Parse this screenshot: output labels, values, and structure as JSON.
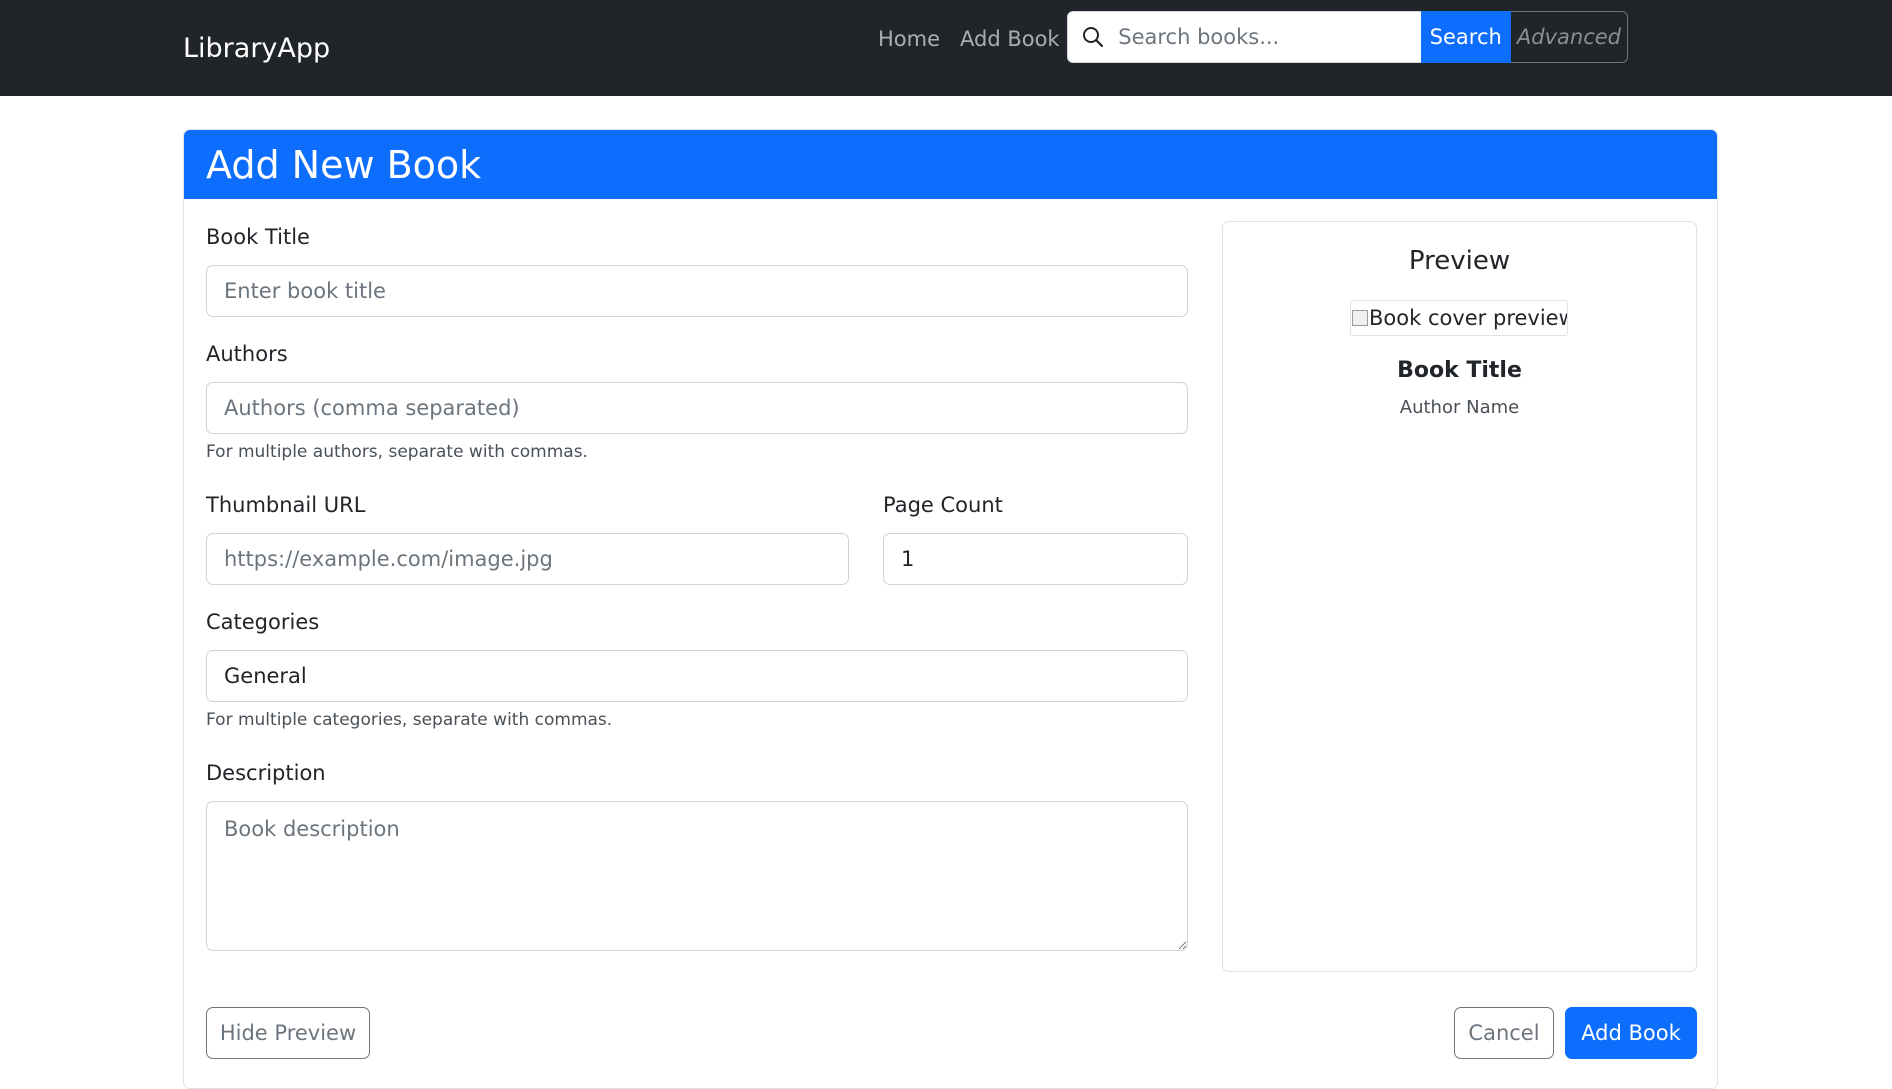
{
  "navbar": {
    "brand": "LibraryApp",
    "links": {
      "home": "Home",
      "add_book": "Add Book"
    },
    "search": {
      "placeholder": "Search books...",
      "button_label": "Search",
      "advanced_label": "Advanced",
      "icon": "search-icon"
    }
  },
  "card": {
    "title": "Add New Book",
    "fields": {
      "title": {
        "label": "Book Title",
        "placeholder": "Enter book title",
        "value": ""
      },
      "authors": {
        "label": "Authors",
        "placeholder": "Authors (comma separated)",
        "value": "",
        "help": "For multiple authors, separate with commas."
      },
      "thumbnail": {
        "label": "Thumbnail URL",
        "placeholder": "https://example.com/image.jpg",
        "value": ""
      },
      "page_count": {
        "label": "Page Count",
        "value": "1"
      },
      "categories": {
        "label": "Categories",
        "value": "General",
        "help": "For multiple categories, separate with commas."
      },
      "description": {
        "label": "Description",
        "placeholder": "Book description",
        "value": ""
      }
    },
    "preview": {
      "heading": "Preview",
      "cover_alt": "Book cover preview",
      "book_title": "Book Title",
      "author": "Author Name"
    },
    "buttons": {
      "hide_preview": "Hide Preview",
      "cancel": "Cancel",
      "add_book": "Add Book"
    }
  },
  "colors": {
    "navbar_bg": "#212529",
    "primary": "#0d6efd",
    "secondary": "#6c757d"
  }
}
